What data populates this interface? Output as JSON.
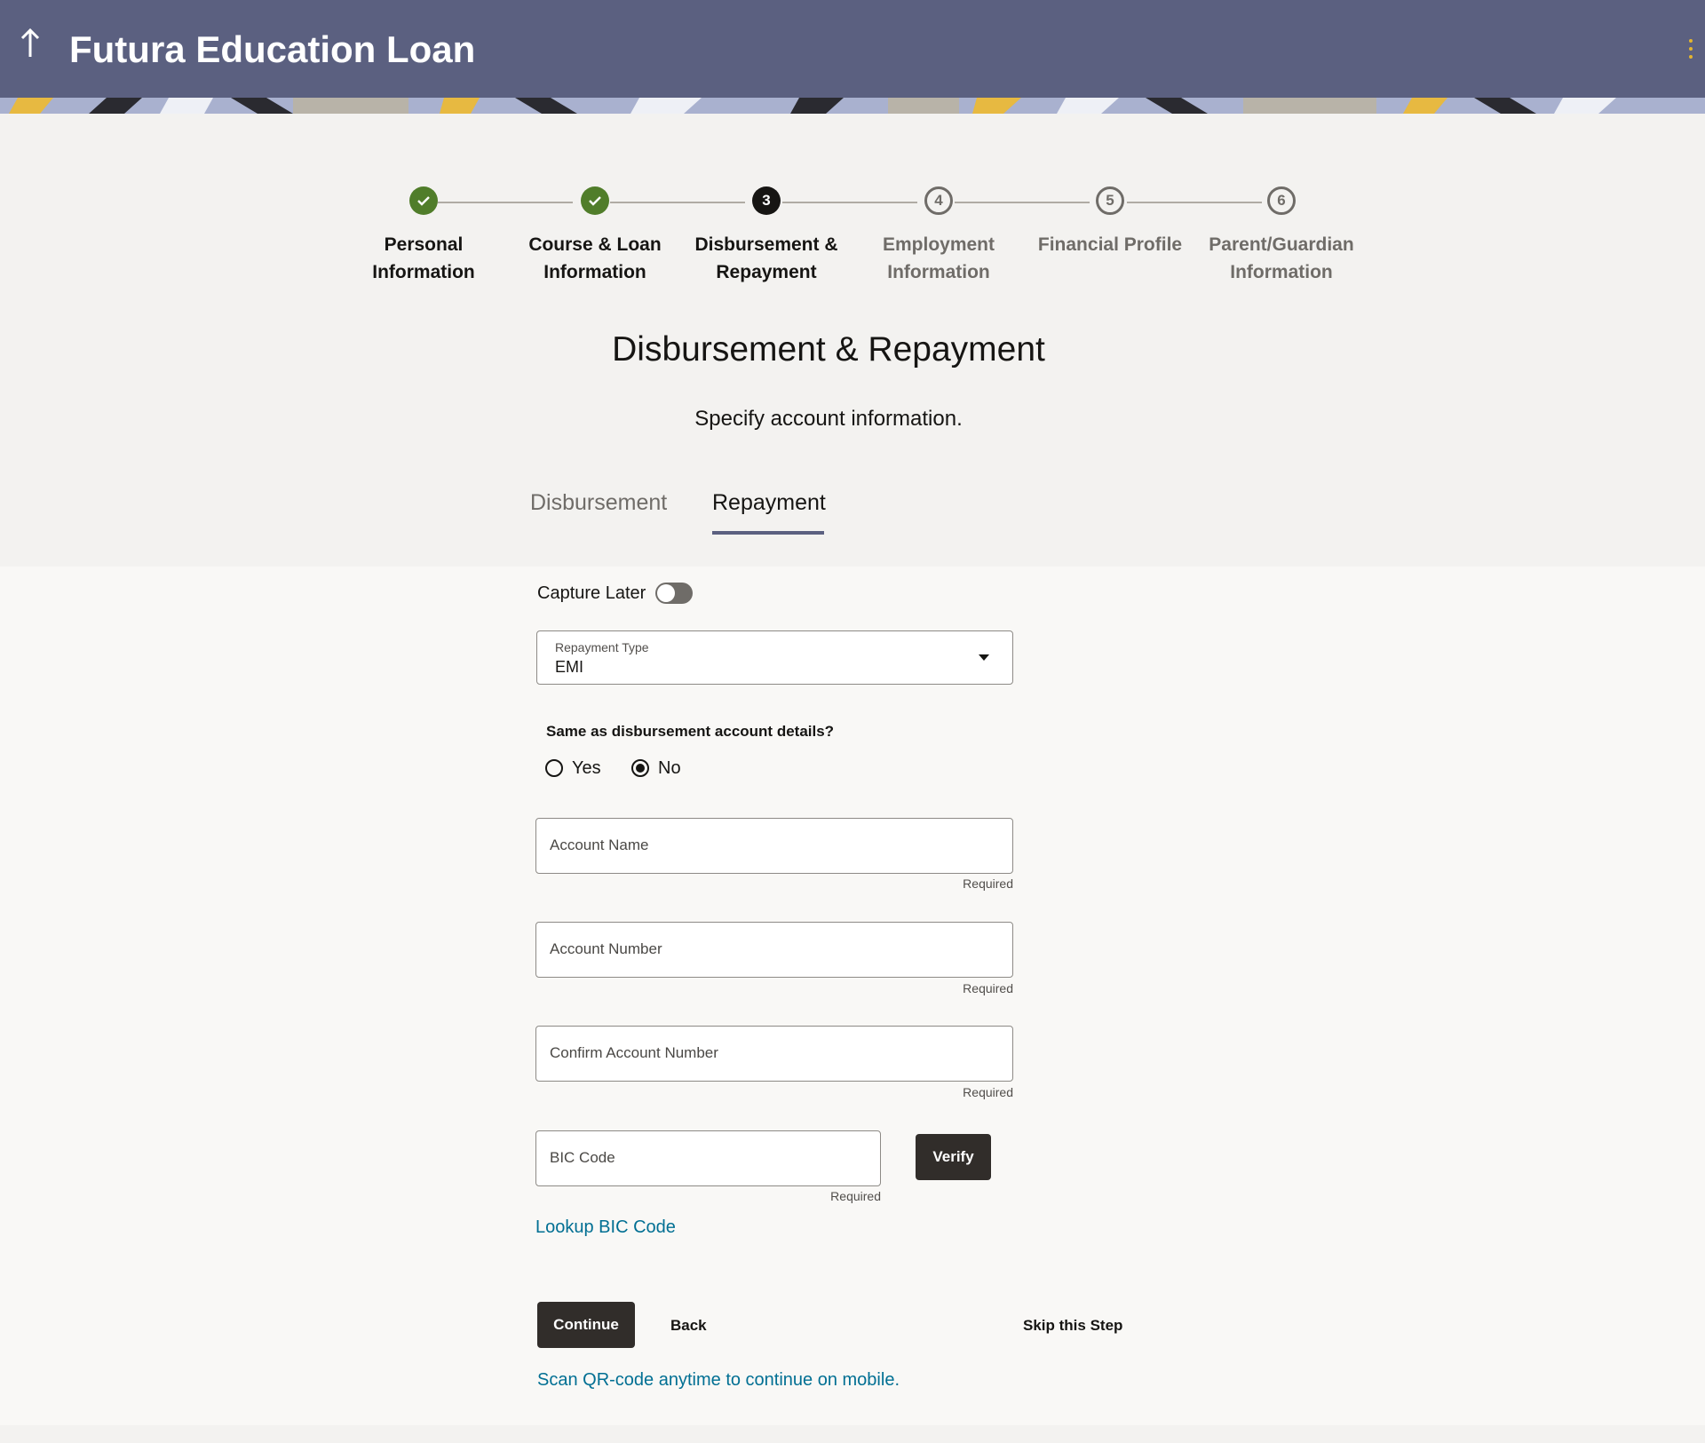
{
  "header": {
    "title": "Futura Education Loan",
    "back_icon": "up-arrow-icon",
    "menu_icon": "kebab-menu-icon",
    "background_color": "#5b6080"
  },
  "stepper": {
    "steps": [
      {
        "number": "1",
        "line1": "Personal",
        "line2": "Information",
        "status": "complete"
      },
      {
        "number": "2",
        "line1": "Course & Loan",
        "line2": "Information",
        "status": "complete"
      },
      {
        "number": "3",
        "line1": "Disbursement &",
        "line2": "Repayment",
        "status": "current"
      },
      {
        "number": "4",
        "line1": "Employment",
        "line2": "Information",
        "status": "pending"
      },
      {
        "number": "5",
        "line1": "Financial Profile",
        "line2": "",
        "status": "pending"
      },
      {
        "number": "6",
        "line1": "Parent/Guardian",
        "line2": "Information",
        "status": "pending"
      }
    ],
    "complete_color": "#507d2a"
  },
  "page": {
    "title": "Disbursement & Repayment",
    "subtitle": "Specify account information."
  },
  "tabs": [
    {
      "label": "Disbursement",
      "selected": false
    },
    {
      "label": "Repayment",
      "selected": true
    }
  ],
  "form": {
    "capture_later_label": "Capture Later",
    "capture_later_on": false,
    "repayment_type": {
      "label": "Repayment Type",
      "value": "EMI"
    },
    "same_as_question": "Same as disbursement account details?",
    "radio_options": [
      {
        "label": "Yes",
        "selected": false
      },
      {
        "label": "No",
        "selected": true
      }
    ],
    "fields": [
      {
        "placeholder": "Account Name",
        "hint": "Required"
      },
      {
        "placeholder": "Account Number",
        "hint": "Required"
      },
      {
        "placeholder": "Confirm Account Number",
        "hint": "Required"
      }
    ],
    "bic": {
      "placeholder": "BIC Code",
      "hint": "Required",
      "verify_label": "Verify"
    },
    "lookup_link": "Lookup BIC Code"
  },
  "actions": {
    "continue": "Continue",
    "back": "Back",
    "skip": "Skip this Step",
    "qr_link": "Scan QR-code anytime to continue on mobile."
  },
  "colors": {
    "link": "#016f93",
    "primary_button": "#312d2a"
  }
}
